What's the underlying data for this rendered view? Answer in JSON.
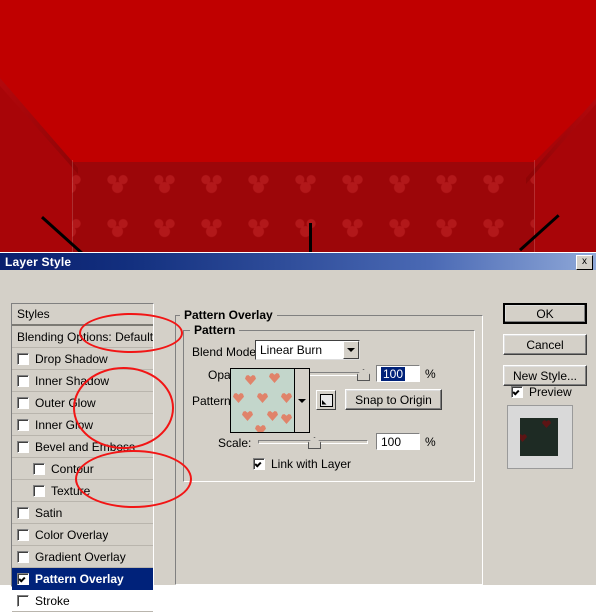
{
  "window": {
    "title": "Layer Style",
    "close_label": "x"
  },
  "styles_panel": {
    "header": "Styles",
    "items": [
      {
        "label": "Blending Options: Default",
        "checkbox": false,
        "has_checkbox": false,
        "indent": false,
        "selected": false
      },
      {
        "label": "Drop Shadow",
        "checkbox": false,
        "has_checkbox": true,
        "indent": false,
        "selected": false
      },
      {
        "label": "Inner Shadow",
        "checkbox": false,
        "has_checkbox": true,
        "indent": false,
        "selected": false
      },
      {
        "label": "Outer Glow",
        "checkbox": false,
        "has_checkbox": true,
        "indent": false,
        "selected": false
      },
      {
        "label": "Inner Glow",
        "checkbox": false,
        "has_checkbox": true,
        "indent": false,
        "selected": false
      },
      {
        "label": "Bevel and Emboss",
        "checkbox": false,
        "has_checkbox": true,
        "indent": false,
        "selected": false
      },
      {
        "label": "Contour",
        "checkbox": false,
        "has_checkbox": true,
        "indent": true,
        "selected": false
      },
      {
        "label": "Texture",
        "checkbox": false,
        "has_checkbox": true,
        "indent": true,
        "selected": false
      },
      {
        "label": "Satin",
        "checkbox": false,
        "has_checkbox": true,
        "indent": false,
        "selected": false
      },
      {
        "label": "Color Overlay",
        "checkbox": false,
        "has_checkbox": true,
        "indent": false,
        "selected": false
      },
      {
        "label": "Gradient Overlay",
        "checkbox": false,
        "has_checkbox": true,
        "indent": false,
        "selected": false
      },
      {
        "label": "Pattern Overlay",
        "checkbox": true,
        "has_checkbox": true,
        "indent": false,
        "selected": true
      },
      {
        "label": "Stroke",
        "checkbox": false,
        "has_checkbox": true,
        "indent": false,
        "selected": false
      }
    ]
  },
  "pattern_overlay": {
    "group_title": "Pattern Overlay",
    "subgroup_title": "Pattern",
    "blend_mode_label": "Blend Mode:",
    "blend_mode_value": "Linear Burn",
    "opacity_label": "Opacity:",
    "opacity_value": "100",
    "opacity_unit": "%",
    "pattern_label": "Pattern:",
    "snap_to_origin_label": "Snap to Origin",
    "scale_label": "Scale:",
    "scale_value": "100",
    "scale_unit": "%",
    "link_with_layer_label": "Link with Layer",
    "link_with_layer_checked": true,
    "swatch_bg_color": "#c3d6cb",
    "swatch_heart_color": "#e0836a"
  },
  "buttons": {
    "ok": "OK",
    "cancel": "Cancel",
    "new_style": "New Style...",
    "preview_label": "Preview",
    "preview_checked": true
  },
  "artwork": {
    "wall_color": "#c00000",
    "lower_wall_color": "#9c0609",
    "preview_swatch_color": "#1e2b24",
    "preview_heart_color": "#5c1414"
  },
  "annotations": {
    "accent_color": "#f21515",
    "ellipse_blend_mode": "blend-mode-ellipse",
    "ellipse_pattern": "pattern-swatch-ellipse",
    "ellipse_link": "link-with-layer-ellipse",
    "ellipse_style_item": "pattern-overlay-item-ellipse"
  }
}
